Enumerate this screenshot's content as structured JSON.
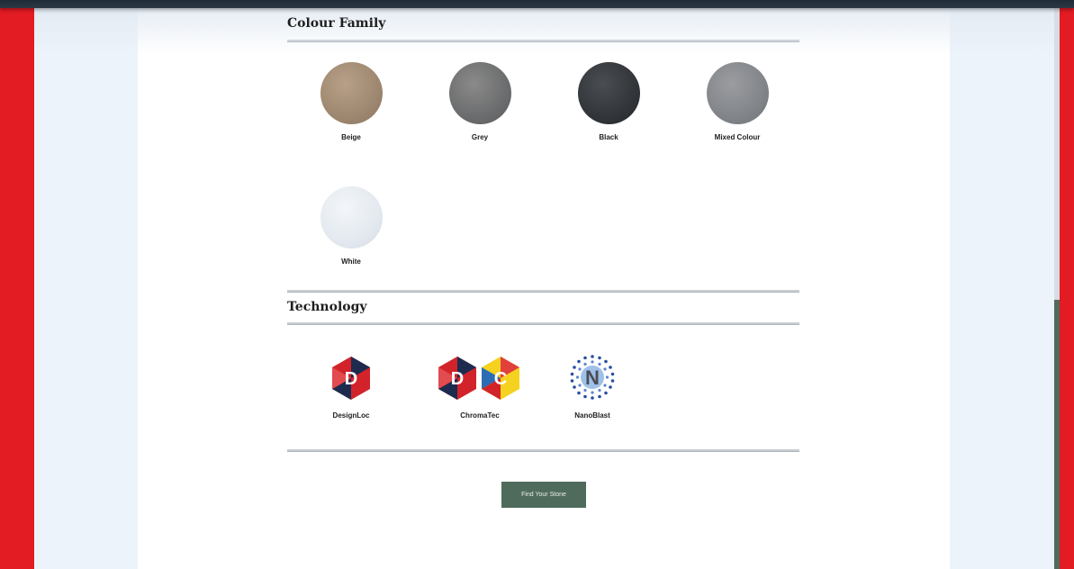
{
  "colour_family": {
    "heading": "Colour Family",
    "swatches": [
      {
        "label": "Beige",
        "color": "#a18a72"
      },
      {
        "label": "Grey",
        "color": "#6e6f70"
      },
      {
        "label": "Black",
        "color": "#34373b"
      },
      {
        "label": "Mixed Colour",
        "color": "#84878b"
      },
      {
        "label": "White",
        "color": "#e3e9ef"
      }
    ]
  },
  "technology": {
    "heading": "Technology",
    "items": [
      {
        "label": "DesignLoc",
        "icon": "designloc-logo-icon",
        "letters": [
          "D"
        ]
      },
      {
        "label": "ChromaTec",
        "icon": "chromatec-logo-icon",
        "letters": [
          "D",
          "C"
        ]
      },
      {
        "label": "NanoBlast",
        "icon": "nanoblast-logo-icon",
        "letters": [
          "N"
        ]
      }
    ]
  },
  "cta": {
    "label": "Find Your Stone"
  },
  "colors": {
    "page_background": "#e31b23",
    "panel": "#edf3fa",
    "content": "#ffffff",
    "accent": "#4f6b5c",
    "logo_red": "#d2232a",
    "logo_navy": "#1d2b4f",
    "logo_yellow": "#f4d21f",
    "logo_blue": "#2a6db5"
  }
}
